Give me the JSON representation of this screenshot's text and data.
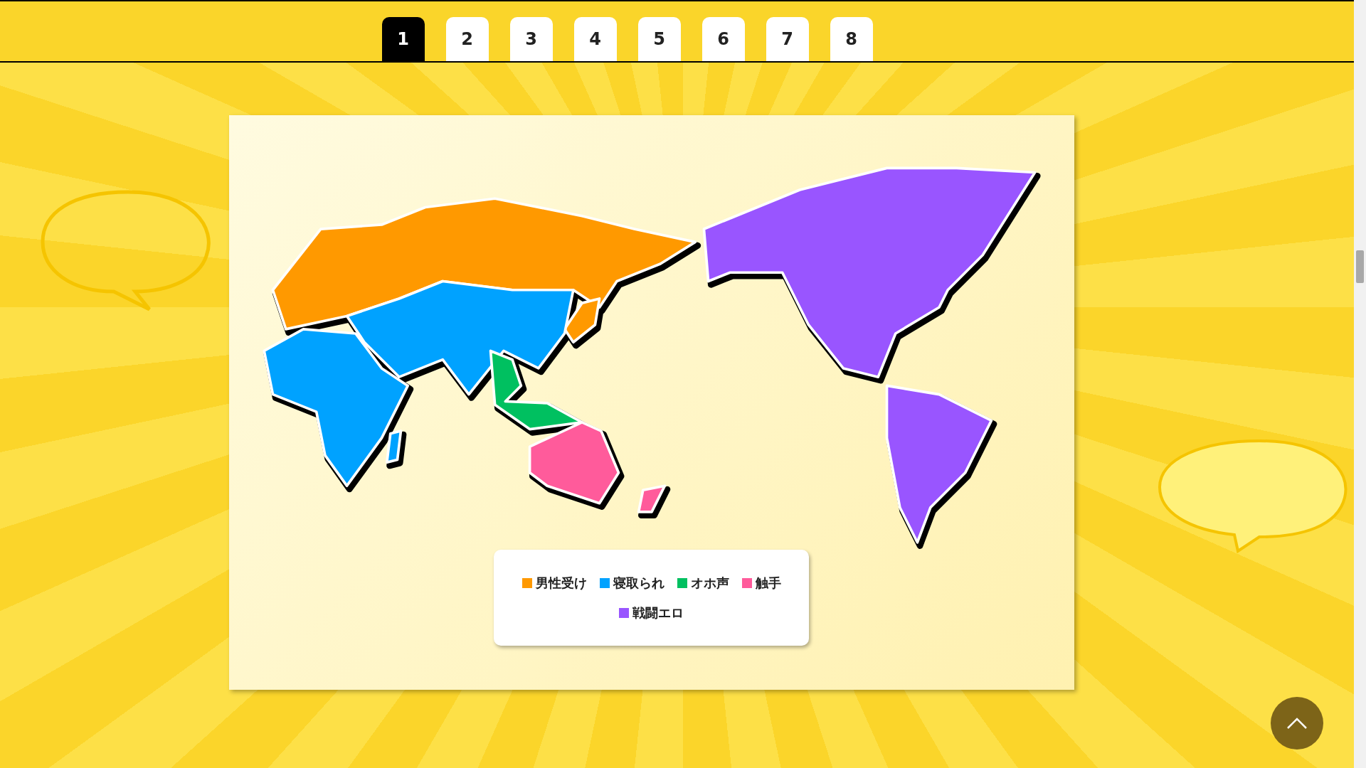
{
  "tabs": [
    {
      "label": "1",
      "selected": true
    },
    {
      "label": "2",
      "selected": false
    },
    {
      "label": "3",
      "selected": false
    },
    {
      "label": "4",
      "selected": false
    },
    {
      "label": "5",
      "selected": false
    },
    {
      "label": "6",
      "selected": false
    },
    {
      "label": "7",
      "selected": false
    },
    {
      "label": "8",
      "selected": false
    }
  ],
  "legend": [
    {
      "label": "男性受け",
      "color": "#ff9900"
    },
    {
      "label": "寝取られ",
      "color": "#00a2ff"
    },
    {
      "label": "オホ声",
      "color": "#00c060"
    },
    {
      "label": "触手",
      "color": "#ff5b9b"
    },
    {
      "label": "戦闘エロ",
      "color": "#9955ff"
    }
  ]
}
